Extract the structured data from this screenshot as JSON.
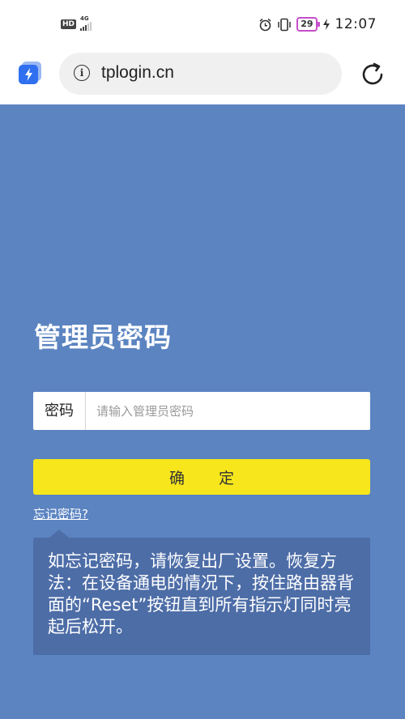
{
  "status_bar": {
    "hd": "HD",
    "network": "4G",
    "battery": "29",
    "time": "12:07"
  },
  "browser": {
    "url": "tplogin.cn"
  },
  "login": {
    "title": "管理员密码",
    "password_label": "密码",
    "password_placeholder": "请输入管理员密码",
    "password_value": "",
    "confirm_button": "确  定",
    "forgot_link": "忘记密码?",
    "tip_text": "如忘记密码，请恢复出厂设置。恢复方法：在设备通电的情况下，按住路由器背面的“Reset”按钮直到所有指示灯同时亮起后松开。"
  },
  "colors": {
    "page_background": "#5b84c1",
    "button": "#f7e61c",
    "tip_box": "#4d6da7",
    "battery_outline": "#c54fc9"
  },
  "icons": [
    "app-icon",
    "info-icon",
    "reload-icon",
    "alarm-icon",
    "vibrate-icon",
    "signal-icon"
  ]
}
